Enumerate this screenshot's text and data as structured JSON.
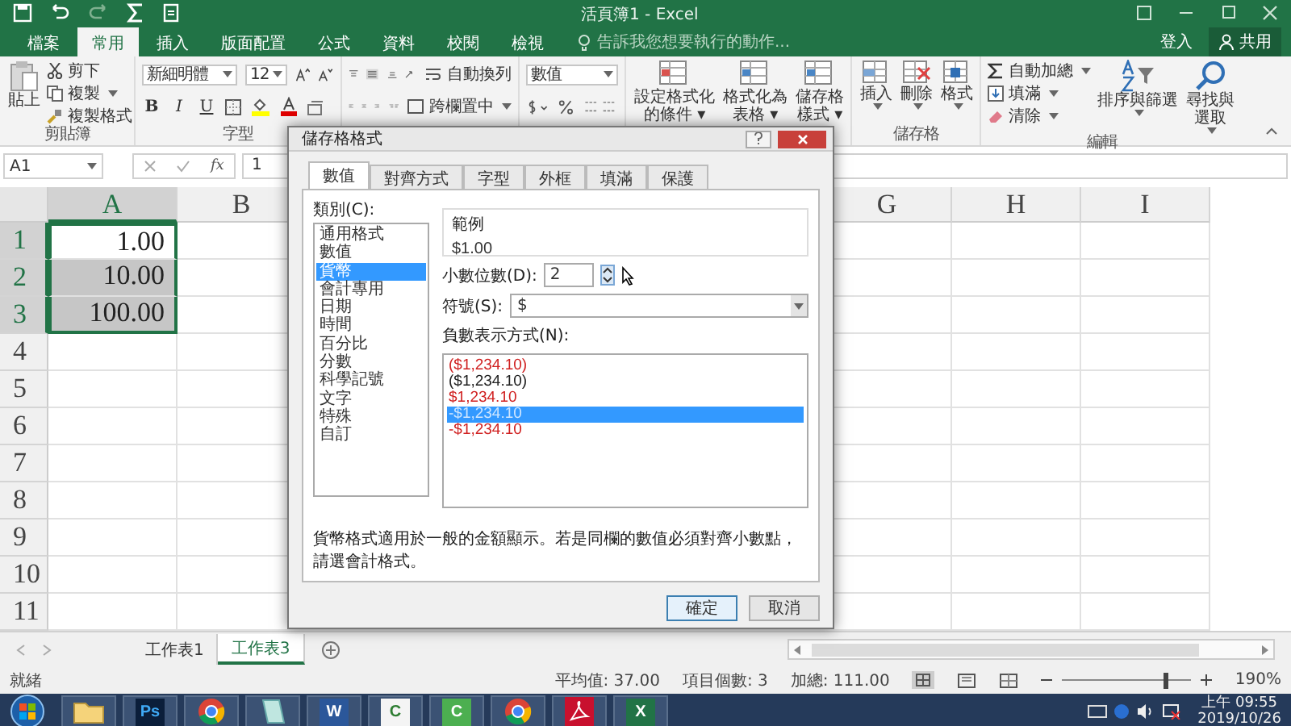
{
  "title_bar": {
    "title": "活頁簿1 - Excel"
  },
  "ribbon_tabs": [
    {
      "label": "檔案",
      "selected": false
    },
    {
      "label": "常用",
      "selected": true
    },
    {
      "label": "插入",
      "selected": false
    },
    {
      "label": "版面配置",
      "selected": false
    },
    {
      "label": "公式",
      "selected": false
    },
    {
      "label": "資料",
      "selected": false
    },
    {
      "label": "校閱",
      "selected": false
    },
    {
      "label": "檢視",
      "selected": false
    }
  ],
  "tell_me": {
    "placeholder": "告訴我您想要執行的動作..."
  },
  "account": {
    "sign_in": "登入",
    "share": "共用"
  },
  "clipboard": {
    "paste": "貼上",
    "cut": "剪下",
    "copy": "複製",
    "format_painter": "複製格式",
    "label": "剪貼簿"
  },
  "font": {
    "name": "新細明體",
    "size": "12",
    "bold": "B",
    "italic": "I",
    "underline": "U",
    "label": "字型"
  },
  "alignment": {
    "wrap_text": "自動換列",
    "merge_center": "跨欄置中"
  },
  "number": {
    "format": "數值"
  },
  "styles": [
    {
      "lines": [
        "設定格式化",
        "的條件 ▾"
      ]
    },
    {
      "lines": [
        "格式化為",
        "表格 ▾"
      ]
    },
    {
      "lines": [
        "儲存格",
        "樣式 ▾"
      ]
    }
  ],
  "cells": {
    "buttons": [
      "插入",
      "刪除",
      "格式"
    ],
    "label": "儲存格"
  },
  "editing": {
    "autosum": "自動加總",
    "fill": "填滿",
    "clear": "清除",
    "sort_filter": [
      "排序與篩選"
    ],
    "find_select": [
      "尋找與",
      "選取"
    ],
    "label": "編輯"
  },
  "formula_bar": {
    "name_box": "A1",
    "function_label": "fx",
    "value": "1"
  },
  "sheet": {
    "columns": [
      "A",
      "B",
      "G",
      "H",
      "I"
    ],
    "rows": [
      {
        "header": "1",
        "value": "1.00",
        "selected": true,
        "active": true
      },
      {
        "header": "2",
        "value": "10.00",
        "selected": true
      },
      {
        "header": "3",
        "value": "100.00",
        "selected": true
      },
      {
        "header": "4",
        "selected": false
      },
      {
        "header": "5",
        "selected": false
      },
      {
        "header": "6",
        "selected": false
      },
      {
        "header": "7",
        "selected": false
      },
      {
        "header": "8",
        "selected": false
      },
      {
        "header": "9",
        "selected": false
      },
      {
        "header": "10",
        "selected": false
      },
      {
        "header": "11",
        "selected": false
      }
    ]
  },
  "sheet_tabs": [
    {
      "label": "工作表1",
      "selected": false
    },
    {
      "label": "工作表3",
      "selected": true
    }
  ],
  "status_bar": {
    "ready": "就緒",
    "average": "平均值: 37.00",
    "count": "項目個數: 3",
    "sum": "加總: 111.00",
    "zoom": {
      "level": 0.8,
      "reading": "190%"
    }
  },
  "taskbar": {
    "apps": [
      {
        "kind": "start"
      },
      {
        "kind": "folder"
      },
      {
        "kind": "photoshop",
        "glyph": "Ps"
      },
      {
        "kind": "chrome"
      },
      {
        "kind": "notes"
      },
      {
        "kind": "word",
        "glyph": "W"
      },
      {
        "kind": "camtasia",
        "glyph": "C"
      },
      {
        "kind": "camtasia-green",
        "glyph": "C"
      },
      {
        "kind": "chrome"
      },
      {
        "kind": "acrobat"
      },
      {
        "kind": "excel",
        "glyph": "X"
      }
    ],
    "time": "上午 09:55",
    "date": "2019/10/26"
  },
  "dialog": {
    "title": "儲存格格式",
    "tabs": [
      {
        "label": "數值",
        "selected": true
      },
      {
        "label": "對齊方式",
        "selected": false
      },
      {
        "label": "字型",
        "selected": false
      },
      {
        "label": "外框",
        "selected": false
      },
      {
        "label": "填滿",
        "selected": false
      },
      {
        "label": "保護",
        "selected": false
      }
    ],
    "category_label": "類別(C):",
    "categories": [
      {
        "label": "通用格式",
        "selected": false
      },
      {
        "label": "數值",
        "selected": false
      },
      {
        "label": "貨幣",
        "selected": true
      },
      {
        "label": "會計專用",
        "selected": false
      },
      {
        "label": "日期",
        "selected": false
      },
      {
        "label": "時間",
        "selected": false
      },
      {
        "label": "百分比",
        "selected": false
      },
      {
        "label": "分數",
        "selected": false
      },
      {
        "label": "科學記號",
        "selected": false
      },
      {
        "label": "文字",
        "selected": false
      },
      {
        "label": "特殊",
        "selected": false
      },
      {
        "label": "自訂",
        "selected": false
      }
    ],
    "sample_label": "範例",
    "sample": "$1.00",
    "decimal_label": "小數位數(D):",
    "decimal": "2",
    "symbol_label": "符號(S):",
    "symbol": "$",
    "negative_label": "負數表示方式(N):",
    "negatives": [
      {
        "text": "($1,234.10)",
        "color": "#d02020",
        "selected": false
      },
      {
        "text": "($1,234.10)",
        "color": "#202020",
        "selected": false
      },
      {
        "text": "$1,234.10",
        "color": "#d02020",
        "selected": false
      },
      {
        "text": "-$1,234.10",
        "selected": true
      },
      {
        "text": "-$1,234.10",
        "color": "#d02020",
        "selected": false
      }
    ],
    "description": "貨幣格式適用於一般的金額顯示。若是同欄的數值必須對齊小數點，請選會計格式。",
    "buttons": [
      "確定",
      "取消"
    ]
  }
}
